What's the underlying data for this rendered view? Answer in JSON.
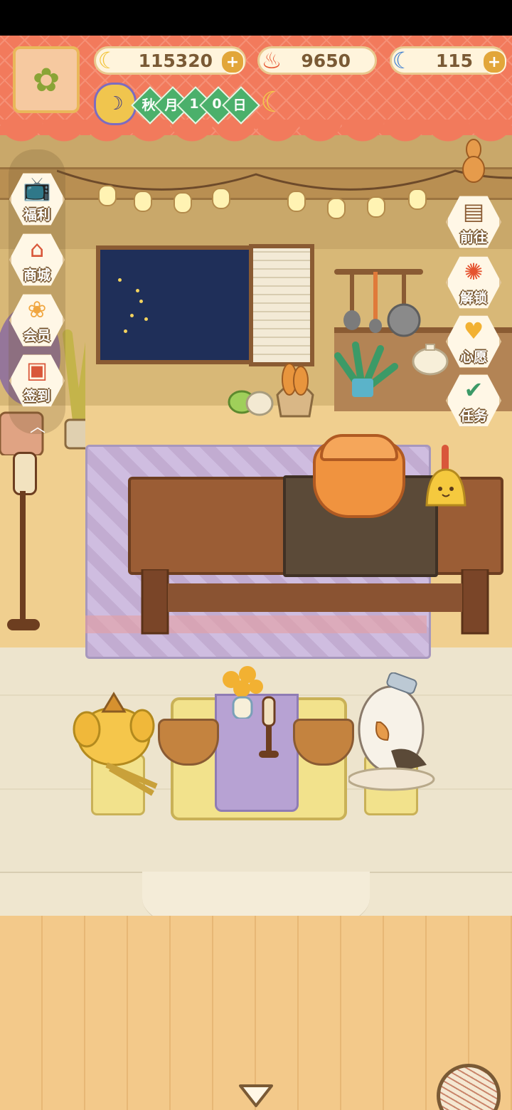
{
  "hud": {
    "currencies": [
      {
        "name": "banana",
        "value": "115320",
        "icon": "banana-icon",
        "plus": "+"
      },
      {
        "name": "flame",
        "value": "9650",
        "icon": "flame-icon",
        "plus": "+"
      },
      {
        "name": "blue-banana",
        "value": "115",
        "icon": "blue-banana-icon",
        "plus": "+"
      }
    ],
    "date": {
      "season": "秋",
      "month_label": "月",
      "day_digits": [
        "1",
        "0"
      ],
      "day_label": "日"
    },
    "time_of_day_icon": "crescent-moon-icon"
  },
  "left_menu": [
    {
      "label": "福利",
      "icon": "tv-icon"
    },
    {
      "label": "商城",
      "icon": "shop-icon"
    },
    {
      "label": "会员",
      "icon": "flower-badge-icon"
    },
    {
      "label": "签到",
      "icon": "calendar-icon"
    }
  ],
  "right_menu": [
    {
      "label": "前往",
      "icon": "signboard-icon"
    },
    {
      "label": "解锁",
      "icon": "key-icon"
    },
    {
      "label": "心愿",
      "icon": "heart-book-icon"
    },
    {
      "label": "任务",
      "icon": "task-jar-icon"
    }
  ],
  "colors": {
    "curtain": "#f27a5c",
    "wood": "#9b5d35",
    "date_diamond": "#4bb06b",
    "currency_plus": "#e2a63a"
  }
}
